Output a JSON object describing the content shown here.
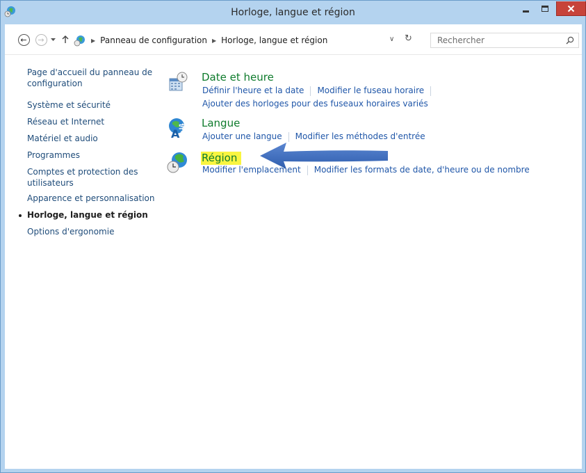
{
  "window": {
    "title": "Horloge, langue et région",
    "accent": "#b4d3ef",
    "close_color": "#c7433a"
  },
  "address": {
    "breadcrumb": [
      "Panneau de configuration",
      "Horloge, langue et région"
    ],
    "search_placeholder": "Rechercher"
  },
  "sidebar": {
    "items": [
      {
        "label": "Page d'accueil du panneau de configuration",
        "current": false
      },
      {
        "label": "Système et sécurité",
        "current": false
      },
      {
        "label": "Réseau et Internet",
        "current": false
      },
      {
        "label": "Matériel et audio",
        "current": false
      },
      {
        "label": "Programmes",
        "current": false
      },
      {
        "label": "Comptes et protection des utilisateurs",
        "current": false
      },
      {
        "label": "Apparence et personnalisation",
        "current": false
      },
      {
        "label": "Horloge, langue et région",
        "current": true
      },
      {
        "label": "Options d'ergonomie",
        "current": false
      }
    ]
  },
  "categories": [
    {
      "title": "Date et heure",
      "icon": "calendar-clock-icon",
      "links": [
        "Définir l'heure et la date",
        "Modifier le fuseau horaire",
        "Ajouter des horloges pour des fuseaux horaires variés"
      ]
    },
    {
      "title": "Langue",
      "icon": "language-globe-icon",
      "links": [
        "Ajouter une langue",
        "Modifier les méthodes d'entrée"
      ]
    },
    {
      "title": "Région",
      "icon": "region-globe-clock-icon",
      "highlight": "#f9f541",
      "links": [
        "Modifier l'emplacement",
        "Modifier les formats de date, d'heure ou de nombre"
      ]
    }
  ],
  "annotation": {
    "arrow_color": "#3e6bc0",
    "points_to": "Région"
  }
}
